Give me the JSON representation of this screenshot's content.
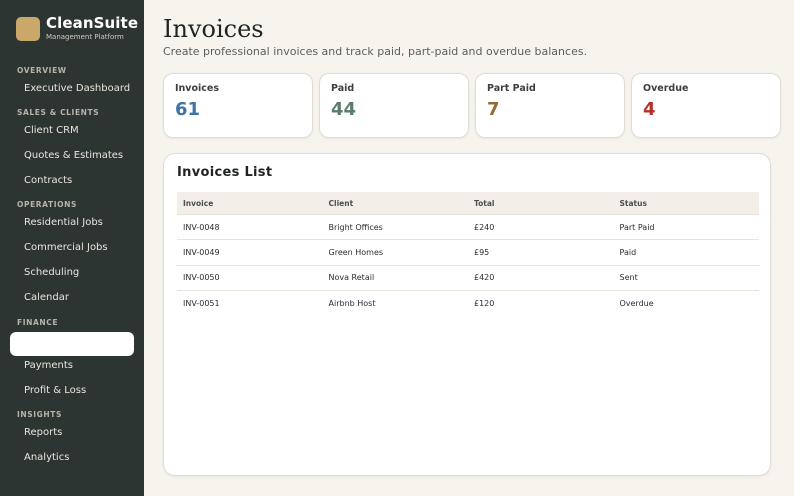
{
  "brand": {
    "name": "CleanSuite",
    "subtitle": "Management Platform"
  },
  "sidebar": {
    "sections": [
      {
        "label": "OVERVIEW",
        "items": [
          {
            "label": "Executive Dashboard"
          }
        ]
      },
      {
        "label": "SALES & CLIENTS",
        "items": [
          {
            "label": "Client CRM"
          },
          {
            "label": "Quotes & Estimates"
          },
          {
            "label": "Contracts"
          }
        ]
      },
      {
        "label": "OPERATIONS",
        "items": [
          {
            "label": "Residential Jobs"
          },
          {
            "label": "Commercial Jobs"
          },
          {
            "label": "Scheduling"
          },
          {
            "label": "Calendar"
          }
        ]
      },
      {
        "label": "FINANCE",
        "items": [
          {
            "label": ""
          },
          {
            "label": "Payments"
          },
          {
            "label": "Profit & Loss"
          }
        ]
      },
      {
        "label": "INSIGHTS",
        "items": [
          {
            "label": "Reports"
          },
          {
            "label": "Analytics"
          }
        ]
      }
    ]
  },
  "page": {
    "title": "Invoices",
    "subtitle": "Create professional invoices and track paid, part-paid and overdue balances."
  },
  "stats": [
    {
      "label": "Invoices",
      "value": "61",
      "color": "#3f74a8"
    },
    {
      "label": "Paid",
      "value": "44",
      "color": "#5a7d6a"
    },
    {
      "label": "Part Paid",
      "value": "7",
      "color": "#8f6c33"
    },
    {
      "label": "Overdue",
      "value": "4",
      "color": "#b5302b"
    }
  ],
  "invoices": {
    "title": "Invoices List",
    "columns": [
      "Invoice",
      "Client",
      "Total",
      "Status"
    ],
    "rows": [
      [
        "INV-0048",
        "Bright Offices",
        "£240",
        "Part Paid"
      ],
      [
        "INV-0049",
        "Green Homes",
        "£95",
        "Paid"
      ],
      [
        "INV-0050",
        "Nova Retail",
        "£420",
        "Sent"
      ],
      [
        "INV-0051",
        "Airbnb Host",
        "£120",
        "Overdue"
      ]
    ]
  }
}
